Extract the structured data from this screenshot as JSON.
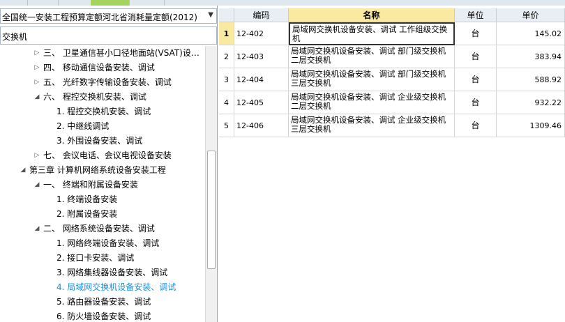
{
  "quota_selector": {
    "value": "全国统一安装工程预算定额河北省消耗量定额(2012)"
  },
  "search": {
    "value": "交换机"
  },
  "tree": [
    {
      "label": "三、  卫星通信甚小口径地面站(VSAT)设…",
      "expanded": false,
      "selected": false
    },
    {
      "label": "四、  移动通信设备安装、调试",
      "expanded": false,
      "selected": false
    },
    {
      "label": "五、  光纤数字传输设备安装、调试",
      "expanded": false,
      "selected": false
    },
    {
      "label": "六、  程控交换机安装、调试",
      "expanded": true,
      "selected": false
    },
    {
      "label": "1. 程控交换机安装、调试",
      "expanded": null,
      "selected": false
    },
    {
      "label": "2. 中继线调试",
      "expanded": null,
      "selected": false
    },
    {
      "label": "3. 外围设备安装、调试",
      "expanded": null,
      "selected": false
    },
    {
      "label": "七、  会议电话、会议电视设备安装",
      "expanded": false,
      "selected": false
    },
    {
      "label": "第三章  计算机网络系统设备安装工程",
      "expanded": true,
      "selected": false
    },
    {
      "label": "一、  终端和附属设备安装",
      "expanded": true,
      "selected": false
    },
    {
      "label": "1. 终端设备安装",
      "expanded": null,
      "selected": false
    },
    {
      "label": "2. 附属设备安装",
      "expanded": null,
      "selected": false
    },
    {
      "label": "二、  网络系统设备安装、调试",
      "expanded": true,
      "selected": false
    },
    {
      "label": "1. 网络终端设备安装、调试",
      "expanded": null,
      "selected": false
    },
    {
      "label": "2. 接口卡安装、调试",
      "expanded": null,
      "selected": false
    },
    {
      "label": "3. 网络集线器设备安装、调试",
      "expanded": null,
      "selected": false
    },
    {
      "label": "4. 局域网交换机设备安装、调试",
      "expanded": null,
      "selected": true
    },
    {
      "label": "5. 路由器设备安装、调试",
      "expanded": null,
      "selected": false
    },
    {
      "label": "6. 防火墙设备安装、调试",
      "expanded": null,
      "selected": false
    }
  ],
  "grid": {
    "headers": {
      "code": "编码",
      "name": "名称",
      "unit": "单位",
      "price": "单价"
    },
    "rows": [
      {
        "num": "1",
        "code": "12-402",
        "name": "局域网交换机设备安装、调试 工作组级交换机",
        "unit": "台",
        "price": "145.02"
      },
      {
        "num": "2",
        "code": "12-403",
        "name": "局域网交换机设备安装、调试 部门级交换机二层交换机",
        "unit": "台",
        "price": "383.94"
      },
      {
        "num": "3",
        "code": "12-404",
        "name": "局域网交换机设备安装、调试 部门级交换机三层交换机",
        "unit": "台",
        "price": "588.92"
      },
      {
        "num": "4",
        "code": "12-405",
        "name": "局域网交换机设备安装、调试 企业级交换机二层交换机",
        "unit": "台",
        "price": "932.22"
      },
      {
        "num": "5",
        "code": "12-406",
        "name": "局域网交换机设备安装、调试 企业级交换机三层交换机",
        "unit": "台",
        "price": "1309.46"
      }
    ]
  },
  "colors": {
    "selected_text": "#1e8fd6",
    "header_highlight": "#fae9a0"
  }
}
